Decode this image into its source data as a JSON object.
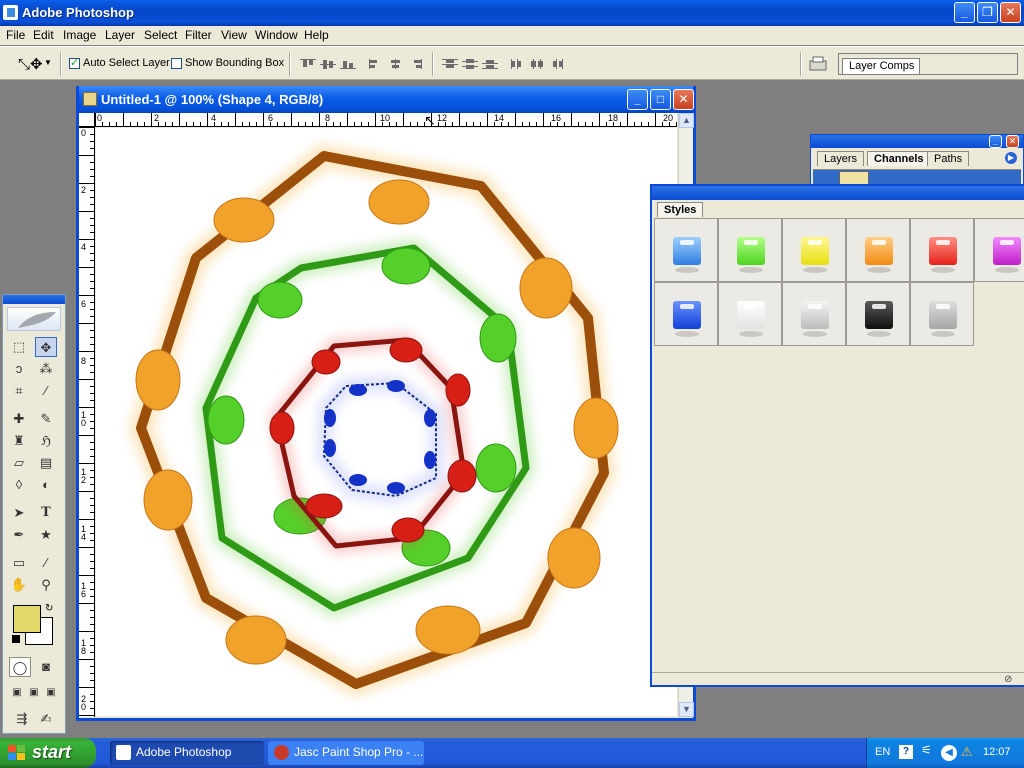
{
  "app": {
    "title": "Adobe Photoshop"
  },
  "menu": [
    "File",
    "Edit",
    "Image",
    "Layer",
    "Select",
    "Filter",
    "View",
    "Window",
    "Help"
  ],
  "options": {
    "auto_select_label": "Auto Select Layer",
    "auto_select_checked": true,
    "show_bounding_label": "Show Bounding Box",
    "show_bounding_checked": false,
    "layer_comps_label": "Layer Comps"
  },
  "document": {
    "title": "Untitled-1 @ 100% (Shape 4, RGB/8)",
    "ruler_h": [
      "0",
      "2",
      "4",
      "6",
      "8",
      "10",
      "12",
      "14",
      "16",
      "18",
      "20"
    ],
    "ruler_v": [
      "0",
      "2",
      "4",
      "6",
      "8",
      "1 0",
      "1 2",
      "1 4",
      "1 6",
      "1 8",
      "2 0"
    ]
  },
  "layers_panel": {
    "tabs": [
      "Layers",
      "Channels",
      "Paths"
    ],
    "active_tab": "Channels"
  },
  "styles_panel": {
    "tab": "Styles",
    "swatches": [
      "#2f7ee0",
      "#4dd41e",
      "#e8df12",
      "#f08a12",
      "#e62219",
      "#c01ec8",
      "#1040d8",
      "#f4f4f4",
      "#d6d6d6",
      "#1a1a1a",
      "#bdbdbd"
    ]
  },
  "colors": {
    "foreground": "#e3d96a",
    "background": "#ffffff"
  },
  "taskbar": {
    "start_label": "start",
    "items": [
      {
        "label": "Adobe Photoshop",
        "active": true
      },
      {
        "label": "Jasc Paint Shop Pro - ...",
        "active": false
      }
    ],
    "language": "EN",
    "clock": "12:07"
  }
}
